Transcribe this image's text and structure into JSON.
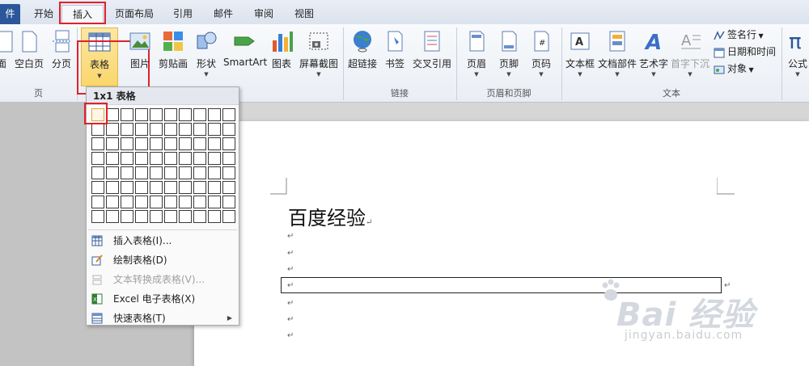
{
  "tabs": {
    "file": "件",
    "items": [
      "开始",
      "插入",
      "页面布局",
      "引用",
      "邮件",
      "审阅",
      "视图"
    ],
    "active": "插入"
  },
  "ribbon": {
    "pages_group": {
      "label": "页",
      "buttons": [
        "面",
        "空白页",
        "分页"
      ]
    },
    "tables_group": {
      "buttons": [
        "表格"
      ]
    },
    "illustrations_group": {
      "buttons": [
        "图片",
        "剪贴画",
        "形状",
        "SmartArt",
        "图表",
        "屏幕截图"
      ]
    },
    "links_group": {
      "label": "链接",
      "buttons": [
        "超链接",
        "书签",
        "交叉引用"
      ]
    },
    "header_footer_group": {
      "label": "页眉和页脚",
      "buttons": [
        "页眉",
        "页脚",
        "页码"
      ]
    },
    "text_group": {
      "label": "文本",
      "buttons": [
        "文本框",
        "文档部件",
        "艺术字",
        "首字下沉"
      ],
      "small_buttons": [
        "签名行",
        "日期和时间",
        "对象"
      ]
    },
    "symbols_group": {
      "buttons": [
        "公式"
      ]
    }
  },
  "table_dropdown": {
    "header": "1x1 表格",
    "grid_rows": 8,
    "grid_cols": 10,
    "highlighted_rows": 1,
    "highlighted_cols": 1,
    "items": [
      {
        "label": "插入表格(I)...",
        "icon": "insert-table-icon",
        "disabled": false
      },
      {
        "label": "绘制表格(D)",
        "icon": "draw-table-icon",
        "disabled": false
      },
      {
        "label": "文本转换成表格(V)...",
        "icon": "convert-text-icon",
        "disabled": true
      },
      {
        "label": "Excel 电子表格(X)",
        "icon": "excel-icon",
        "disabled": false
      },
      {
        "label": "快速表格(T)",
        "icon": "quick-table-icon",
        "disabled": false
      }
    ]
  },
  "document": {
    "title": "百度经验",
    "para_mark": "↵"
  },
  "watermark": {
    "logo_text": "Bai 经验",
    "url": "jingyan.baidu.com"
  },
  "colors": {
    "accent_red": "#e0212b",
    "file_tab": "#2b579a",
    "selected_button": "#f9d76c"
  }
}
